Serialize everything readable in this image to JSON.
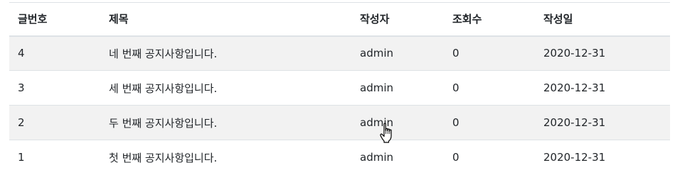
{
  "table": {
    "headers": [
      "글번호",
      "제목",
      "작성자",
      "조회수",
      "작성일"
    ],
    "rows": [
      {
        "no": "4",
        "title": "네 번째 공지사항입니다.",
        "author": "admin",
        "views": "0",
        "date": "2020-12-31"
      },
      {
        "no": "3",
        "title": "세 번째 공지사항입니다.",
        "author": "admin",
        "views": "0",
        "date": "2020-12-31"
      },
      {
        "no": "2",
        "title": "두 번째 공지사항입니다.",
        "author": "admin",
        "views": "0",
        "date": "2020-12-31"
      },
      {
        "no": "1",
        "title": "첫 번째 공지사항입니다.",
        "author": "admin",
        "views": "0",
        "date": "2020-12-31"
      }
    ]
  },
  "cursor": {
    "icon": "hand-pointer-icon"
  },
  "colors": {
    "stripe": "#f2f2f2",
    "border": "#dee2e6",
    "text": "#212529"
  }
}
